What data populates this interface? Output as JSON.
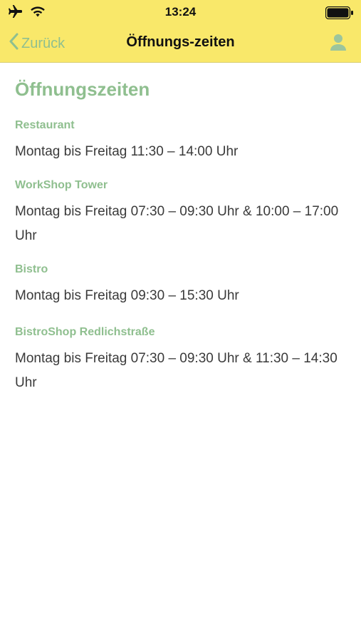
{
  "status_bar": {
    "time": "13:24"
  },
  "nav": {
    "back_label": "Zurück",
    "title": "Öffnungs-zeiten"
  },
  "page": {
    "title": "Öffnungszeiten",
    "sections": [
      {
        "name": "Restaurant",
        "hours": "Montag bis Freitag 11:30 – 14:00 Uhr"
      },
      {
        "name": "WorkShop Tower",
        "hours": "Montag bis Freitag 07:30 – 09:30 Uhr & 10:00 – 17:00 Uhr"
      },
      {
        "name": "Bistro",
        "hours": "Montag bis Freitag 09:30 – 15:30 Uhr"
      },
      {
        "name": "BistroShop Redlichstraße",
        "hours": "Montag bis Freitag 07:30 – 09:30 Uhr & 11:30 – 14:30 Uhr"
      }
    ]
  },
  "colors": {
    "header_bg": "#f9e86a",
    "accent_green": "#8fbf8f",
    "text": "#3a3a3a"
  }
}
